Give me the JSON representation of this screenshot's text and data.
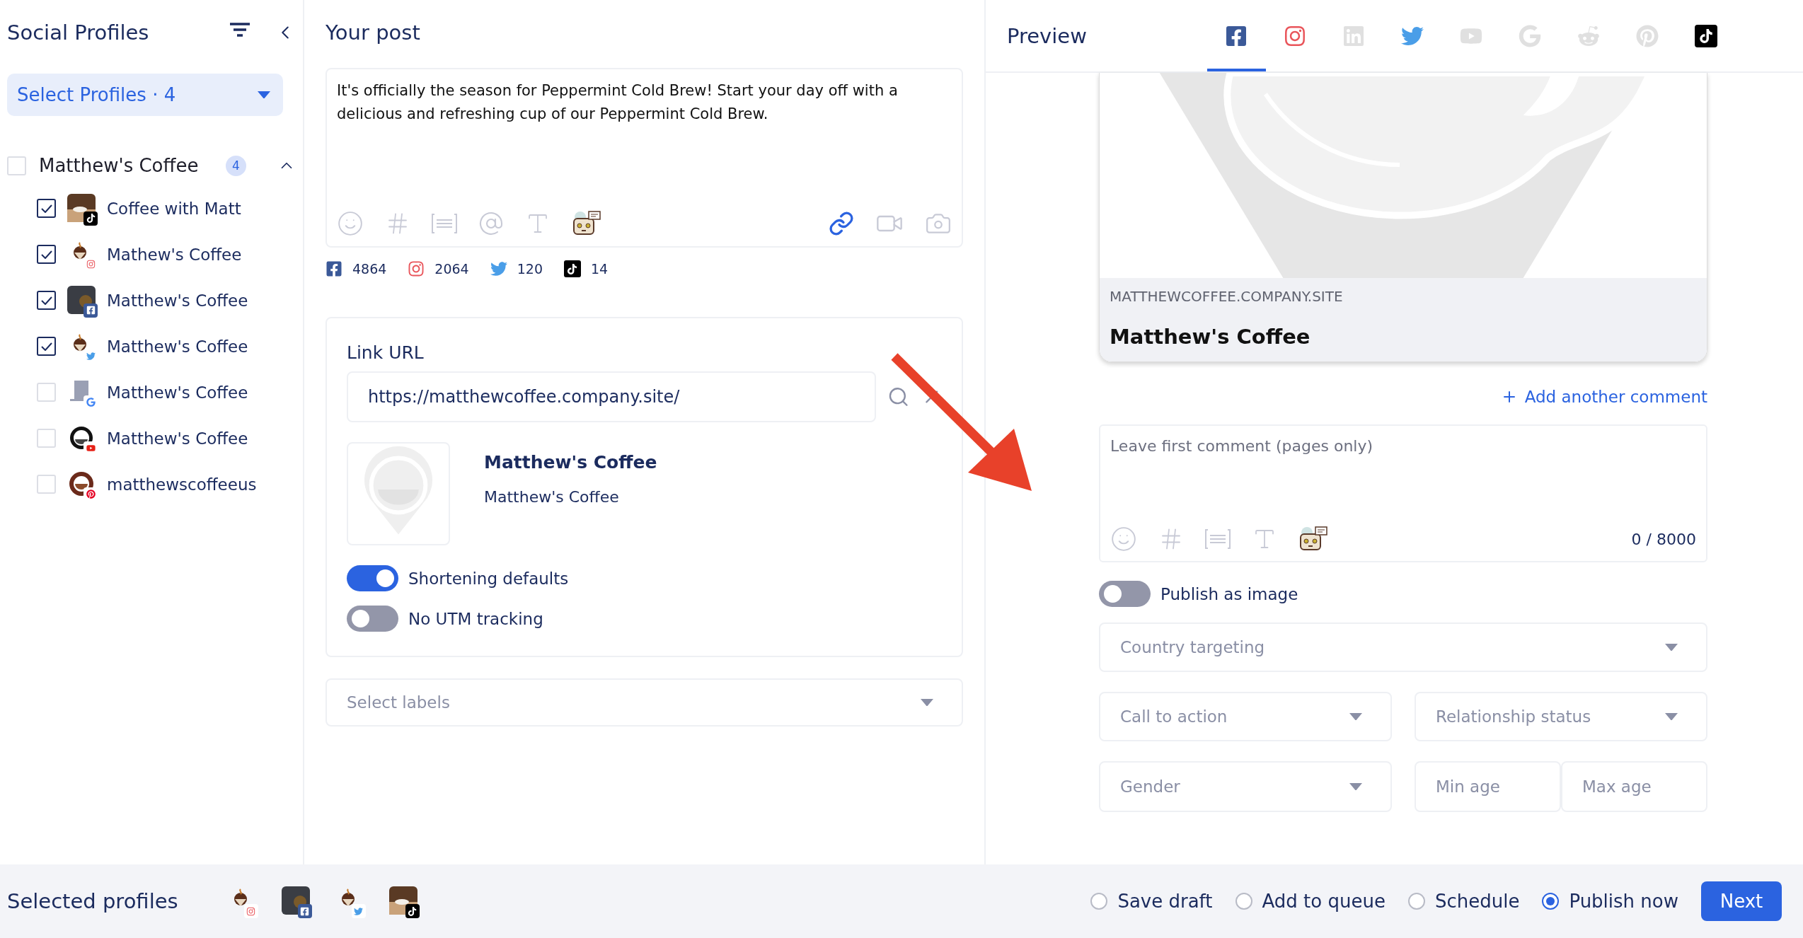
{
  "sidebar": {
    "title": "Social Profiles",
    "select_button": "Select Profiles · 4",
    "group": {
      "name": "Matthew's Coffee",
      "checked": false,
      "expanded": true,
      "count": "4",
      "profiles": [
        {
          "name": "Coffee with Matt",
          "kind": "tiktok",
          "checked": true
        },
        {
          "name": "Mathew's Coffee",
          "kind": "instagram",
          "checked": true
        },
        {
          "name": "Matthew's Coffee",
          "kind": "facebook",
          "checked": true
        },
        {
          "name": "Matthew's Coffee",
          "kind": "twitter",
          "checked": true
        },
        {
          "name": "Matthew's Coffee",
          "kind": "google",
          "checked": false
        },
        {
          "name": "Matthew's Coffee",
          "kind": "youtube",
          "checked": false
        },
        {
          "name": "matthewscoffeeus",
          "kind": "pinterest",
          "checked": false
        }
      ]
    }
  },
  "post": {
    "title": "Your post",
    "text": "It's officially the season for Peppermint Cold Brew! Start your day off with a delicious and refreshing cup of our Peppermint Cold Brew.",
    "counts": [
      {
        "kind": "facebook",
        "count": "4864"
      },
      {
        "kind": "instagram",
        "count": "2064"
      },
      {
        "kind": "twitter",
        "count": "120"
      },
      {
        "kind": "tiktok",
        "count": "14"
      }
    ],
    "link": {
      "label": "Link URL",
      "url": "https://matthewcoffee.company.site/",
      "title": "Matthew's Coffee",
      "description": "Matthew's Coffee",
      "toggles": [
        {
          "label": "Shortening defaults",
          "on": true
        },
        {
          "label": "No UTM tracking",
          "on": false
        }
      ]
    },
    "labels_placeholder": "Select labels"
  },
  "preview": {
    "title": "Preview",
    "networks": [
      {
        "kind": "facebook",
        "selected": true,
        "active": true
      },
      {
        "kind": "instagram",
        "selected": false,
        "active": true
      },
      {
        "kind": "linkedin",
        "selected": false,
        "active": false
      },
      {
        "kind": "twitter",
        "selected": false,
        "active": true
      },
      {
        "kind": "youtube",
        "selected": false,
        "active": false
      },
      {
        "kind": "google",
        "selected": false,
        "active": false
      },
      {
        "kind": "reddit",
        "selected": false,
        "active": false
      },
      {
        "kind": "pinterest",
        "selected": false,
        "active": false
      },
      {
        "kind": "tiktok",
        "selected": false,
        "active": true
      }
    ],
    "card": {
      "domain": "MATTHEWCOFFEE.COMPANY.SITE",
      "title": "Matthew's Coffee"
    },
    "add_comment": "Add another comment",
    "comment": {
      "placeholder": "Leave first comment (pages only)",
      "counter": "0 / 8000"
    },
    "publish_as_image": {
      "label": "Publish as image",
      "on": false
    },
    "country": "Country targeting",
    "call_to_action": "Call to action",
    "relationship": "Relationship status",
    "gender": "Gender",
    "min_age": {
      "placeholder": "Min age"
    },
    "max_age": {
      "placeholder": "Max age"
    }
  },
  "footer": {
    "title": "Selected profiles",
    "profiles": [
      {
        "kind": "instagram"
      },
      {
        "kind": "facebook"
      },
      {
        "kind": "twitter"
      },
      {
        "kind": "tiktok"
      }
    ],
    "options": [
      {
        "label": "Save draft",
        "selected": false
      },
      {
        "label": "Add to queue",
        "selected": false
      },
      {
        "label": "Schedule",
        "selected": false
      },
      {
        "label": "Publish now",
        "selected": true
      }
    ],
    "next": "Next"
  }
}
